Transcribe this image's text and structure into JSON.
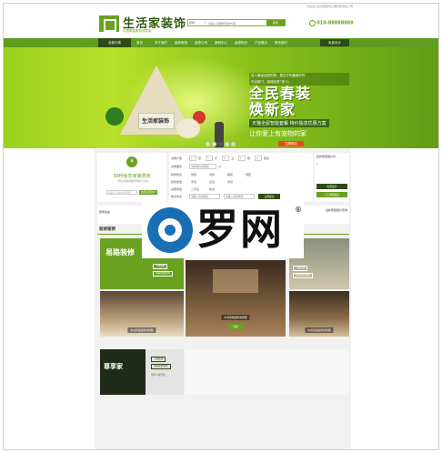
{
  "topbar": {
    "note": "欢迎进入生活家装饰工程有限责任公司"
  },
  "header": {
    "logo_title": "生活家装饰",
    "logo_sub": "中国家装服务领导者",
    "search_select": "装修",
    "search_placeholder": "请输入您要搜索的内容",
    "search_button": "搜索",
    "phone": "010-88888888"
  },
  "nav": {
    "all_label": "全部分类",
    "items": [
      "首页",
      "关于我们",
      "装修案例",
      "装修公司",
      "案例中心",
      "装修知识",
      "产品展示",
      "联系我们"
    ],
    "right_label": "免费设计"
  },
  "banner": {
    "tent_sign": "生活家装饰",
    "small_line1": "给人最高品质的家，居住于你最美好的",
    "small_line2": "不出家门，装修品质“放”心",
    "headline1": "全民春装",
    "headline2": "焕新家",
    "tag": "天猫全屋智能套餐 特价独享优惠方案",
    "line3": "让你爱上有宠物的家",
    "cta": "立即报名",
    "dots": [
      false,
      false,
      true,
      false,
      false
    ]
  },
  "quote": {
    "icon": "¥",
    "title": "30秒给您家装费用",
    "subtitle": "一键获取精准装修报价方案",
    "input_placeholder": "请输入您的手机号码",
    "button": "立即免费报价"
  },
  "form": {
    "rows": [
      {
        "label": "房屋户型",
        "fields": [
          "1",
          "室",
          "1",
          "厅",
          "1",
          "卫",
          "1",
          "厨",
          "1",
          "阳台"
        ]
      },
      {
        "label": "房屋面积",
        "fields": [
          "请选择房屋面积",
          "㎡"
        ]
      },
      {
        "label": "装修档次",
        "fields": [
          "简装",
          "中装",
          "精装",
          "豪装"
        ]
      },
      {
        "label": "装修类型",
        "fields": [
          "半包",
          "全包",
          "清包"
        ]
      },
      {
        "label": "房屋类型",
        "fields": [
          "二手房",
          "新房"
        ]
      },
      {
        "label": "联系信息",
        "fields": [
          "请输入您的姓名",
          "请输入您的电话"
        ]
      }
    ],
    "submit": "立即提交"
  },
  "side": {
    "heading": "您的家装报价为",
    "amount": "?",
    "button1": "免费设计",
    "button2": "人工精准报价"
  },
  "strip": {
    "left": "装修动态",
    "right": "最新家装报价查询"
  },
  "section": {
    "title": "装修案例"
  },
  "tiles": {
    "green_big": "易路装修",
    "green_btn1": "了解装修",
    "green_btn2": "查看装修案例",
    "dark_big": "尊享家",
    "dark_sub": "尊享人生乐家",
    "dark_btn1": "了解装修",
    "dark_btn2": "查看装修案例",
    "right_top_btn1": "了解装修",
    "right_top_btn2": "查看装修案例",
    "photo_caps": [
      "中式风格装修效果图",
      "中式风格装修效果图",
      "中式风格装修效果图",
      "中式风格装修效果图"
    ],
    "view_button": "查看"
  },
  "watermark": {
    "text": "罗网",
    "reg": "®"
  },
  "colors": {
    "accent": "#6aa121",
    "dark": "#2f4b14",
    "cta": "#e84c1e"
  }
}
